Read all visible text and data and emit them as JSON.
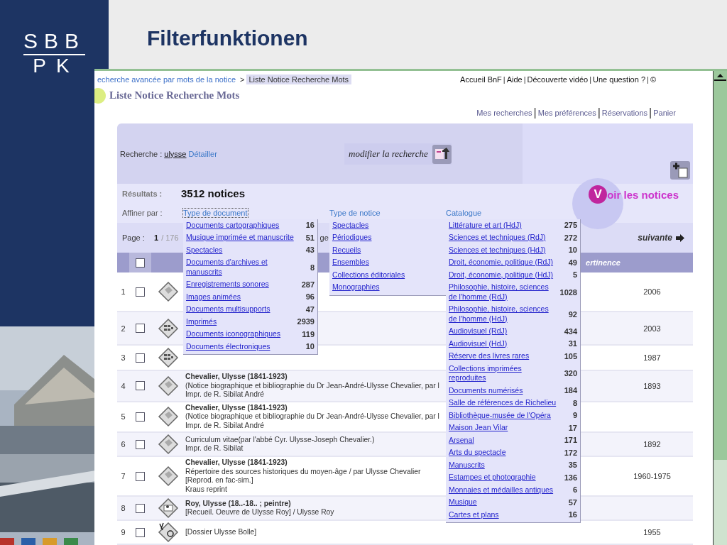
{
  "slide": {
    "logo": [
      "SBB",
      "PK"
    ],
    "title": "Filterfunktionen"
  },
  "breadcrumb": {
    "separator": ">",
    "items": [
      {
        "label": "echerche avancée par mots de la notice",
        "selected": false
      },
      {
        "label": "Liste Notice Recherche Mots",
        "selected": true
      }
    ]
  },
  "top_links": {
    "separator": "|",
    "items": [
      "Accueil BnF",
      "Aide",
      "Découverte vidéo",
      "Une question ?",
      "©"
    ]
  },
  "page_title": "Liste Notice Recherche Mots",
  "user_links": {
    "separator": "|",
    "items": [
      "Mes recherches",
      "Mes préférences",
      "Réservations",
      "Panier"
    ]
  },
  "search": {
    "label": "Recherche :",
    "query": "ulysse",
    "detail_link": "Détailler",
    "modify_button": "modifier la recherche"
  },
  "results": {
    "label": "Résultats :",
    "count": "3512 notices"
  },
  "refine": {
    "label": "Affiner par :",
    "facets": [
      {
        "label": "Type de document",
        "focused": true,
        "expanded": true,
        "items": [
          {
            "label": "Documents cartographiques",
            "count": "16"
          },
          {
            "label": "Musique imprimée et manuscrite",
            "count": "51"
          },
          {
            "label": "Spectacles",
            "count": "43"
          },
          {
            "label": "Documents d'archives et manuscrits",
            "count": "8"
          },
          {
            "label": "Enregistrements sonores",
            "count": "287"
          },
          {
            "label": "Images animées",
            "count": "96"
          },
          {
            "label": "Documents multisupports",
            "count": "47"
          },
          {
            "label": "Imprimés",
            "count": "2939"
          },
          {
            "label": "Documents iconographiques",
            "count": "119"
          },
          {
            "label": "Documents électroniques",
            "count": "10"
          }
        ]
      },
      {
        "label": "Type de notice",
        "focused": false,
        "expanded": true,
        "items": [
          {
            "label": "Spectacles"
          },
          {
            "label": "Périodiques"
          },
          {
            "label": "Recueils"
          },
          {
            "label": "Ensembles"
          },
          {
            "label": "Collections éditoriales"
          },
          {
            "label": "Monographies"
          }
        ]
      },
      {
        "label": "Catalogue",
        "focused": false,
        "expanded": true,
        "items": [
          {
            "label": "Littérature et art (HdJ)",
            "count": "275"
          },
          {
            "label": "Sciences et techniques (RdJ)",
            "count": "272"
          },
          {
            "label": "Sciences et techniques (HdJ)",
            "count": "10"
          },
          {
            "label": "Droit, économie, politique (RdJ)",
            "count": "49"
          },
          {
            "label": "Droit, économie, politique (HdJ)",
            "count": "5"
          },
          {
            "label": "Philosophie, histoire, sciences de l'homme (RdJ)",
            "count": "1028"
          },
          {
            "label": "Philosophie, histoire, sciences de l'homme (HdJ)",
            "count": "92"
          },
          {
            "label": "Audiovisuel (RdJ)",
            "count": "434"
          },
          {
            "label": "Audiovisuel (HdJ)",
            "count": "31"
          },
          {
            "label": "Réserve des livres rares",
            "count": "105"
          },
          {
            "label": "Collections imprimées reproduites",
            "count": "320"
          },
          {
            "label": "Documents numérisés",
            "count": "184"
          },
          {
            "label": "Salle de références de Richelieu",
            "count": "8"
          },
          {
            "label": "Bibliothèque-musée de l'Opéra",
            "count": "9"
          },
          {
            "label": "Maison Jean Vilar",
            "count": "17"
          },
          {
            "label": "Arsenal",
            "count": "171"
          },
          {
            "label": "Arts du spectacle",
            "count": "172"
          },
          {
            "label": "Manuscrits",
            "count": "35"
          },
          {
            "label": "Estampes et photographie",
            "count": "136"
          },
          {
            "label": "Monnaies et médailles antiques",
            "count": "6"
          },
          {
            "label": "Musique",
            "count": "57"
          },
          {
            "label": "Cartes et plans",
            "count": "16"
          }
        ]
      }
    ]
  },
  "voir_button": {
    "initial": "V",
    "label": "oir les notices"
  },
  "pager": {
    "label": "Page :",
    "current": "1",
    "total": "/ 176",
    "fragment": "ge",
    "next": "suivante"
  },
  "table": {
    "select_all": {
      "checked": false
    },
    "column_fragment": "ertinence",
    "rows": [
      {
        "number": "1",
        "checked": false,
        "kind": "book",
        "date": "2006"
      },
      {
        "number": "2",
        "checked": false,
        "kind": "serial",
        "date": "2003"
      },
      {
        "number": "3",
        "checked": false,
        "kind": "serial",
        "date": "1987"
      },
      {
        "number": "4",
        "checked": false,
        "kind": "book",
        "author": "Chevalier, Ulysse (1841-1923)",
        "lines": [
          "(Notice biographique et bibliographie du Dr Jean-André-Ulysse Chevalier, par l",
          "Impr. de R. Sibilat André"
        ],
        "date": "1893"
      },
      {
        "number": "5",
        "checked": false,
        "kind": "book",
        "author": "Chevalier, Ulysse (1841-1923)",
        "lines": [
          "(Notice biographique et bibliographie du Dr Jean-André-Ulysse Chevalier, par l",
          "Impr. de R. Sibilat André"
        ]
      },
      {
        "number": "6",
        "checked": false,
        "kind": "book",
        "lines": [
          "Curriculum vitae(par l'abbé Cyr. Ulysse-Joseph Chevalier.)",
          "Impr. de R. Sibilat"
        ],
        "date": "1892"
      },
      {
        "number": "7",
        "checked": false,
        "kind": "book",
        "author": "Chevalier, Ulysse (1841-1923)",
        "lines": [
          "Répertoire des sources historiques du moyen-âge / par Ulysse Chevalier",
          "[Reprod. en fac-sim.]",
          "Kraus reprint"
        ],
        "date": "1960-1975"
      },
      {
        "number": "8",
        "checked": false,
        "kind": "collection",
        "author": "Roy, Ulysse (18..-18.. ; peintre)",
        "lines": [
          "[Recueil. Oeuvre de Ulysse Roy] / Ulysse Roy"
        ]
      },
      {
        "number": "9",
        "checked": false,
        "kind": "mixed",
        "lines": [
          "[Dossier Ulysse Bolle]"
        ],
        "date": "1955"
      }
    ]
  }
}
